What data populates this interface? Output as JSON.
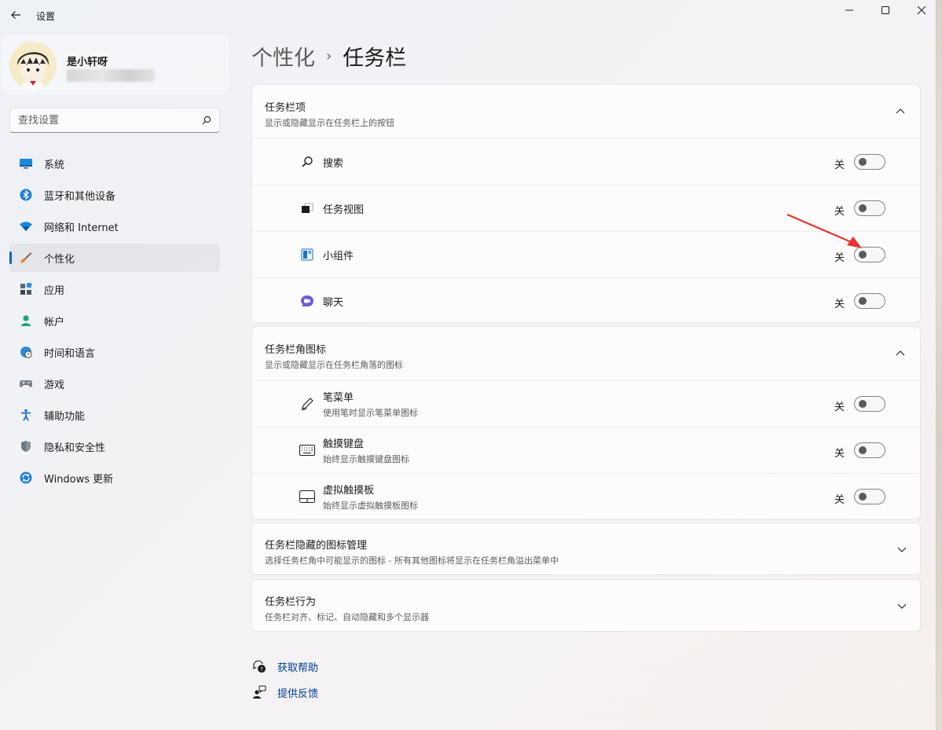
{
  "app_title": "设置",
  "window_controls": {
    "minimize": "—",
    "maximize": "☐",
    "close": "✕"
  },
  "profile": {
    "name": "是小轩呀"
  },
  "search": {
    "placeholder": "查找设置"
  },
  "sidebar": {
    "items": [
      {
        "label": "系统",
        "icon": "monitor-icon"
      },
      {
        "label": "蓝牙和其他设备",
        "icon": "bluetooth-icon"
      },
      {
        "label": "网络和 Internet",
        "icon": "wifi-icon"
      },
      {
        "label": "个性化",
        "icon": "brush-icon",
        "active": true
      },
      {
        "label": "应用",
        "icon": "apps-icon"
      },
      {
        "label": "帐户",
        "icon": "person-icon"
      },
      {
        "label": "时间和语言",
        "icon": "clock-globe-icon"
      },
      {
        "label": "游戏",
        "icon": "gamepad-icon"
      },
      {
        "label": "辅助功能",
        "icon": "accessibility-icon"
      },
      {
        "label": "隐私和安全性",
        "icon": "shield-icon"
      },
      {
        "label": "Windows 更新",
        "icon": "update-icon"
      }
    ]
  },
  "breadcrumb": {
    "parent": "个性化",
    "separator": "›",
    "current": "任务栏"
  },
  "sections": {
    "taskbar_items": {
      "title": "任务栏项",
      "subtitle": "显示或隐藏显示在任务栏上的按钮",
      "rows": [
        {
          "label": "搜索",
          "state": "关"
        },
        {
          "label": "任务视图",
          "state": "关"
        },
        {
          "label": "小组件",
          "state": "关"
        },
        {
          "label": "聊天",
          "state": "关"
        }
      ]
    },
    "corner_icons": {
      "title": "任务栏角图标",
      "subtitle": "显示或隐藏显示在任务栏角落的图标",
      "rows": [
        {
          "label": "笔菜单",
          "desc": "使用笔时显示笔菜单图标",
          "state": "关"
        },
        {
          "label": "触摸键盘",
          "desc": "始终显示触摸键盘图标",
          "state": "关"
        },
        {
          "label": "虚拟触摸板",
          "desc": "始终显示虚拟触摸板图标",
          "state": "关"
        }
      ]
    },
    "overflow": {
      "title": "任务栏隐藏的图标管理",
      "subtitle": "选择任务栏角中可能显示的图标 - 所有其他图标将显示在任务栏角溢出菜单中"
    },
    "behaviors": {
      "title": "任务栏行为",
      "subtitle": "任务栏对齐、标记、自动隐藏和多个显示器"
    }
  },
  "links": {
    "help": "获取帮助",
    "feedback": "提供反馈"
  },
  "colors": {
    "accent": "#0067c0",
    "link": "#003e92",
    "annotation_arrow": "#e8342b"
  }
}
